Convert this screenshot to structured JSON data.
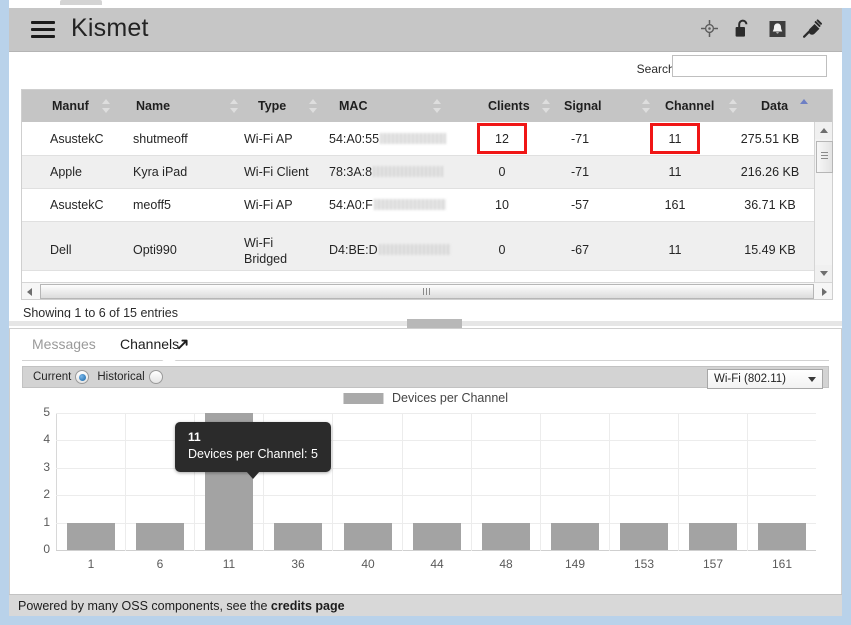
{
  "app": {
    "title": "Kismet",
    "menu_icon": "hamburger-icon",
    "nav_icons": [
      "gps-crosshair-icon",
      "unlocked-padlock-icon",
      "bell-alert-icon",
      "plug-disconnected-icon"
    ]
  },
  "search": {
    "label": "Search:",
    "value": "",
    "placeholder": ""
  },
  "table": {
    "columns": [
      {
        "label": "Manuf",
        "sorted": false
      },
      {
        "label": "Name",
        "sorted": false
      },
      {
        "label": "Type",
        "sorted": false
      },
      {
        "label": "MAC",
        "sorted": false
      },
      {
        "label": "Clients",
        "sorted": false
      },
      {
        "label": "Signal",
        "sorted": false
      },
      {
        "label": "Channel",
        "sorted": false
      },
      {
        "label": "Data",
        "sorted": true
      }
    ],
    "rows": [
      {
        "manuf": "AsustekC",
        "name": "shutmeoff",
        "type": "Wi-Fi AP",
        "mac": "54:A0:55",
        "clients": "12",
        "signal": "-71",
        "channel": "11",
        "data": "275.51 KB"
      },
      {
        "manuf": "Apple",
        "name": "Kyra iPad",
        "type": "Wi-Fi Client",
        "mac": "78:3A:8",
        "clients": "0",
        "signal": "-71",
        "channel": "11",
        "data": "216.26 KB"
      },
      {
        "manuf": "AsustekC",
        "name": "meoff5",
        "type": "Wi-Fi AP",
        "mac": "54:A0:F",
        "clients": "10",
        "signal": "-57",
        "channel": "161",
        "data": "36.71 KB"
      },
      {
        "manuf": "Dell",
        "name": "Opti990",
        "type": "Wi-Fi Bridged",
        "mac": "D4:BE:D",
        "clients": "0",
        "signal": "-67",
        "channel": "11",
        "data": "15.49 KB"
      }
    ],
    "status": "Showing 1 to 6 of 15 entries",
    "highlight_color": "#f01616"
  },
  "lower_panel": {
    "tabs": [
      {
        "label": "Messages",
        "active": false
      },
      {
        "label": "Channels",
        "active": true
      }
    ],
    "expand_icon": "expand-diagonal-icon",
    "mode": {
      "current_label": "Current",
      "historical_label": "Historical",
      "selected": "Current"
    },
    "phy_select": {
      "value": "Wi-Fi (802.11)",
      "options": [
        "Wi-Fi (802.11)"
      ]
    }
  },
  "chart_data": {
    "type": "bar",
    "title": "",
    "legend": [
      "Devices per Channel"
    ],
    "legend_position": "top-center",
    "series_color": "#a3a3a3",
    "categories": [
      "1",
      "6",
      "11",
      "36",
      "40",
      "44",
      "48",
      "149",
      "153",
      "157",
      "161"
    ],
    "values": [
      1,
      1,
      5,
      1,
      1,
      1,
      1,
      1,
      1,
      1,
      1
    ],
    "xlabel": "",
    "ylabel": "",
    "ylim": [
      0,
      5
    ],
    "yticks": [
      "0",
      "1",
      "2",
      "3",
      "4",
      "5"
    ],
    "grid": true,
    "tooltip": {
      "category": "11",
      "text": "Devices per Channel: 5",
      "visible": true
    }
  },
  "footer": {
    "text_before": "Powered by many OSS components, see the ",
    "link": "credits page"
  }
}
